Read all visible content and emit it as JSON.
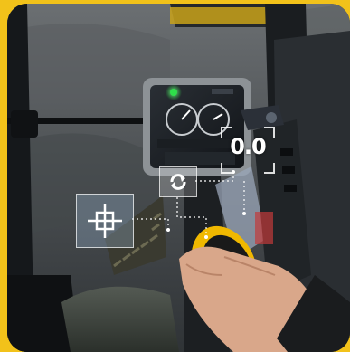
{
  "colors": {
    "frame": "#f2c21a",
    "hud_line": "#ffffff",
    "joystick": "#f0b800",
    "indicator": "#2ee04a"
  },
  "hud": {
    "readout": "0.0"
  },
  "icons": {
    "rotate": "rotate-icon",
    "target": "crosshair-target-icon"
  }
}
